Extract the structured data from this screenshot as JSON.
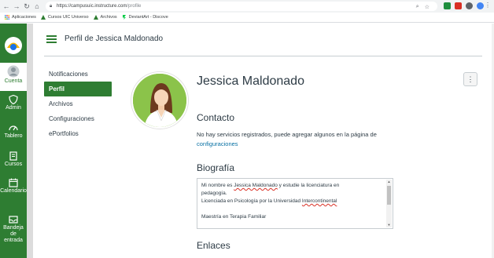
{
  "browser": {
    "url_host": "https://campusuic.instructure.com",
    "url_path": "/profile",
    "bookmarks": [
      {
        "label": "Aplicaciones",
        "icon": "apps-grid-icon"
      },
      {
        "label": "Cursos UIC Universo",
        "icon": "canvas-bookmark-icon"
      },
      {
        "label": "Archivos",
        "icon": "canvas-bookmark-icon"
      },
      {
        "label": "DeviantArt - Discove",
        "icon": "deviantart-icon"
      }
    ]
  },
  "global_nav": {
    "items": [
      {
        "label": "Cuenta",
        "icon": "account-avatar-icon"
      },
      {
        "label": "Admin",
        "icon": "shield-icon"
      },
      {
        "label": "Tablero",
        "icon": "dashboard-gauge-icon"
      },
      {
        "label": "Cursos",
        "icon": "courses-book-icon"
      },
      {
        "label": "Calendario",
        "icon": "calendar-icon"
      },
      {
        "label": "Bandeja de entrada",
        "icon": "inbox-icon"
      }
    ],
    "accent": "#2e7d32"
  },
  "header": {
    "title": "Perfil de Jessica Maldonado"
  },
  "subnav": {
    "items": [
      {
        "label": "Notificaciones",
        "active": false
      },
      {
        "label": "Perfil",
        "active": true
      },
      {
        "label": "Archivos",
        "active": false
      },
      {
        "label": "Configuraciones",
        "active": false
      },
      {
        "label": "ePortfolios",
        "active": false
      }
    ]
  },
  "profile": {
    "name": "Jessica Maldonado",
    "contact_heading": "Contacto",
    "contact_text": "No hay servicios registrados, puede agregar algunos en la página de",
    "contact_link": "configuraciones",
    "bio_heading": "Biografía",
    "bio_lines": [
      "Mi nombre es Jessica Maldonado y estudie la licenciatura en",
      "pedagogía.",
      "Licenciada en Psicología por la Universidad Intercontinental",
      "",
      "Maestría en Terapia Familiar"
    ],
    "links_heading": "Enlaces"
  },
  "colors": {
    "link": "#0770a3",
    "text": "#2d3b45",
    "avatar_bg": "#8bc34a"
  }
}
